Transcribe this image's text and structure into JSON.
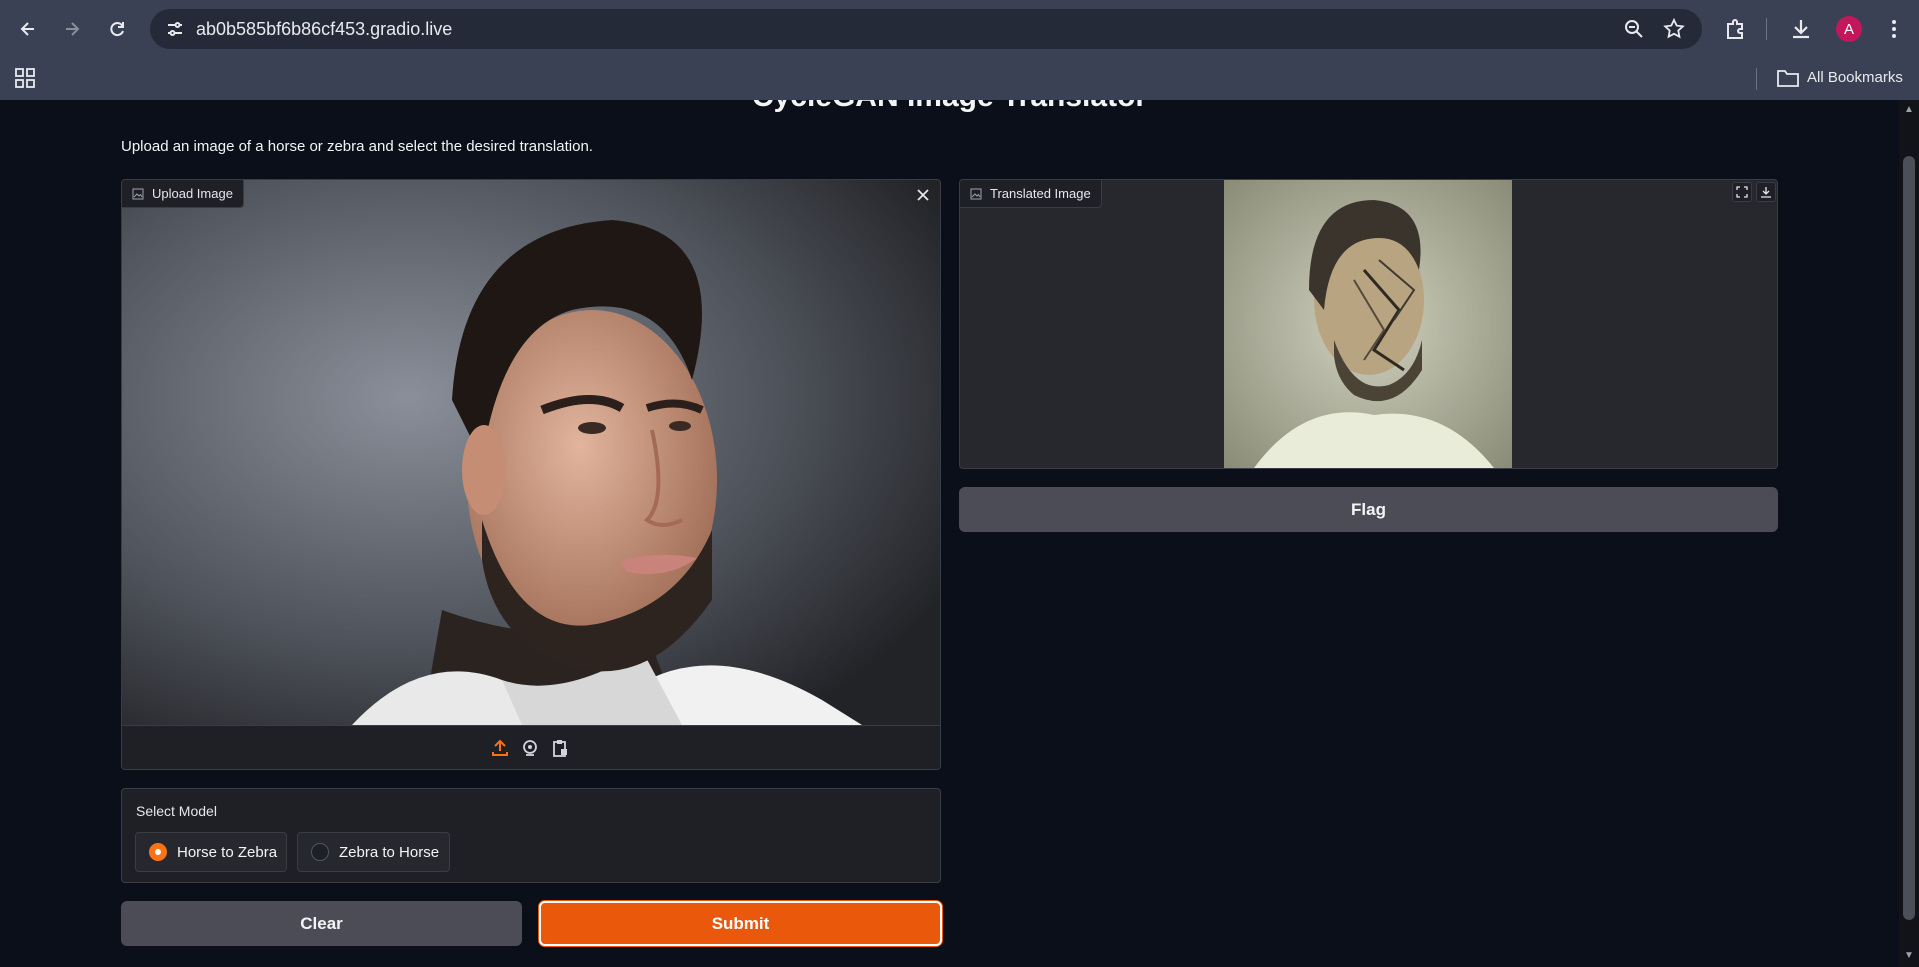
{
  "browser": {
    "url": "ab0b585bf6b86cf453.gradio.live",
    "profile_initial": "A",
    "bookmarks_label": "All Bookmarks",
    "icons": [
      "back-icon",
      "forward-icon",
      "reload-icon",
      "site-settings-icon",
      "zoom-icon",
      "star-icon",
      "extensions-icon",
      "download-icon",
      "menu-icon",
      "apps-icon",
      "folder-icon"
    ]
  },
  "app": {
    "title": "CycleGAN Image Translator",
    "description": "Upload an image of a horse or zebra and select the desired translation."
  },
  "upload": {
    "label": "Upload Image",
    "sources": [
      "upload-icon",
      "webcam-icon",
      "clipboard-icon"
    ]
  },
  "output": {
    "label": "Translated Image"
  },
  "flag_label": "Flag",
  "model": {
    "label": "Select Model",
    "options": [
      {
        "label": "Horse to Zebra",
        "selected": true
      },
      {
        "label": "Zebra to Horse",
        "selected": false
      }
    ]
  },
  "actions": {
    "clear_label": "Clear",
    "submit_label": "Submit"
  },
  "colors": {
    "accent": "#ea580c",
    "background": "#0b0f19",
    "panel": "#1f2026",
    "secondary_button": "#4b4c56"
  }
}
